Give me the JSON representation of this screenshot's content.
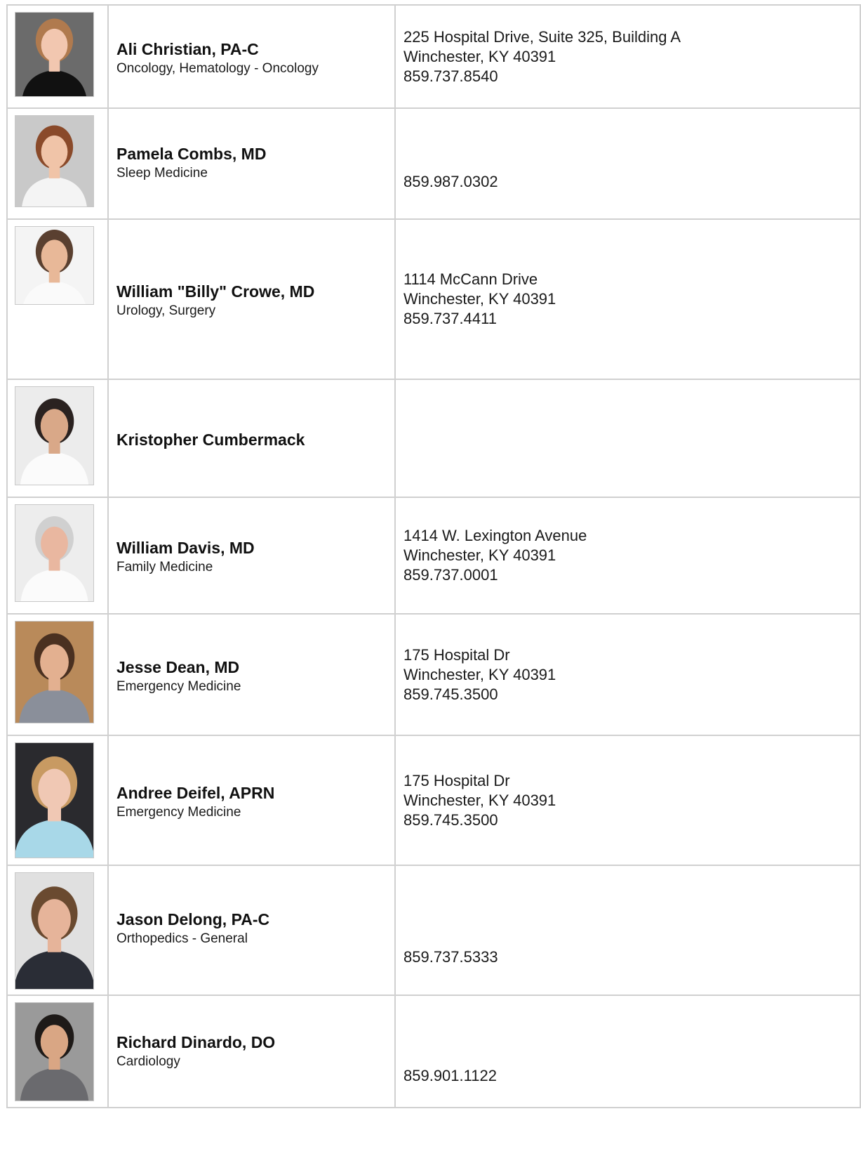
{
  "providers": [
    {
      "name": "Ali Christian, PA-C",
      "specialty": "Oncology, Hematology - Oncology",
      "address_line1": "225 Hospital Drive, Suite 325, Building A",
      "address_line2": "Winchester, KY 40391",
      "phone": "859.737.8540",
      "photo_bg": "#6b6b6b",
      "photo_skin": "#f2c7b0",
      "photo_hair": "#b07a4e",
      "photo_clothes": "#111111"
    },
    {
      "name": "Pamela Combs, MD",
      "specialty": "Sleep Medicine",
      "address_line1": "",
      "address_line2": "",
      "phone": "859.987.0302",
      "photo_bg": "#c9c9c9",
      "photo_skin": "#f0c4a8",
      "photo_hair": "#8a4a2a",
      "photo_clothes": "#f4f4f4"
    },
    {
      "name": "William \"Billy\" Crowe, MD",
      "specialty": "Urology, Surgery",
      "address_line1": "1114 McCann Drive",
      "address_line2": "Winchester, KY 40391",
      "phone": "859.737.4411",
      "photo_bg": "#f4f4f4",
      "photo_skin": "#e8b898",
      "photo_hair": "#5a4030",
      "photo_clothes": "#fafafa"
    },
    {
      "name": "Kristopher Cumbermack",
      "specialty": "",
      "address_line1": "",
      "address_line2": "",
      "phone": "",
      "photo_bg": "#ececec",
      "photo_skin": "#d9a888",
      "photo_hair": "#2a2220",
      "photo_clothes": "#fbfbfb"
    },
    {
      "name": "William Davis, MD",
      "specialty": "Family Medicine",
      "address_line1": "1414 W. Lexington Avenue",
      "address_line2": "Winchester, KY 40391",
      "phone": "859.737.0001",
      "photo_bg": "#ededed",
      "photo_skin": "#e9b7a0",
      "photo_hair": "#d0d0d0",
      "photo_clothes": "#fbfbfb"
    },
    {
      "name": "Jesse Dean, MD",
      "specialty": "Emergency Medicine",
      "address_line1": "175 Hospital Dr",
      "address_line2": "Winchester, KY 40391",
      "phone": "859.745.3500",
      "photo_bg": "#b98a5a",
      "photo_skin": "#e3b090",
      "photo_hair": "#4a3020",
      "photo_clothes": "#8a8f9a"
    },
    {
      "name": "Andree Deifel, APRN",
      "specialty": "Emergency Medicine",
      "address_line1": "175 Hospital Dr",
      "address_line2": "Winchester, KY 40391",
      "phone": "859.745.3500",
      "photo_bg": "#2a2a2e",
      "photo_skin": "#f0c8b4",
      "photo_hair": "#c89a62",
      "photo_clothes": "#a8d8e8"
    },
    {
      "name": "Jason Delong, PA-C",
      "specialty": "Orthopedics - General",
      "address_line1": "",
      "address_line2": "",
      "phone": "859.737.5333",
      "photo_bg": "#e0e0e0",
      "photo_skin": "#e6b49a",
      "photo_hair": "#6a4a30",
      "photo_clothes": "#2a2d36"
    },
    {
      "name": "Richard Dinardo, DO",
      "specialty": "Cardiology",
      "address_line1": "",
      "address_line2": "",
      "phone": "859.901.1122",
      "photo_bg": "#9a9a9a",
      "photo_skin": "#d9a684",
      "photo_hair": "#1e1a18",
      "photo_clothes": "#6a6a6e"
    }
  ]
}
